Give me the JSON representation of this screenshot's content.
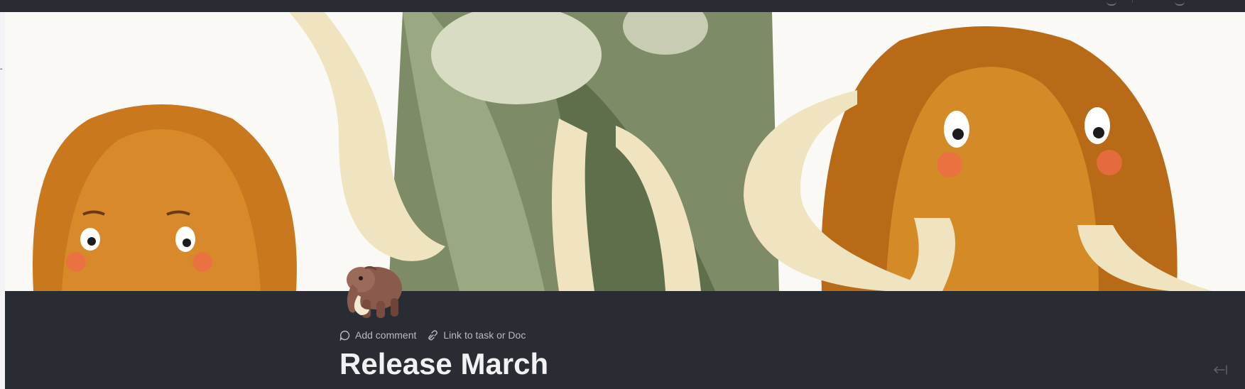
{
  "document": {
    "title": "Release March",
    "cover_description_icon": "mammoth-emoji"
  },
  "actions": {
    "add_comment": "Add comment",
    "link_task": "Link to task or Doc"
  },
  "icons": {
    "comment": "comment-bubble-icon",
    "link": "link-icon",
    "collapse": "collapse-left-icon"
  },
  "colors": {
    "background": "#2a2c33",
    "title_text": "#f2f2f4",
    "action_text": "#b8bac2",
    "mammoth_orange": "#c9781e",
    "mammoth_green": "#6f7f5a",
    "tusk": "#efe4bf"
  }
}
